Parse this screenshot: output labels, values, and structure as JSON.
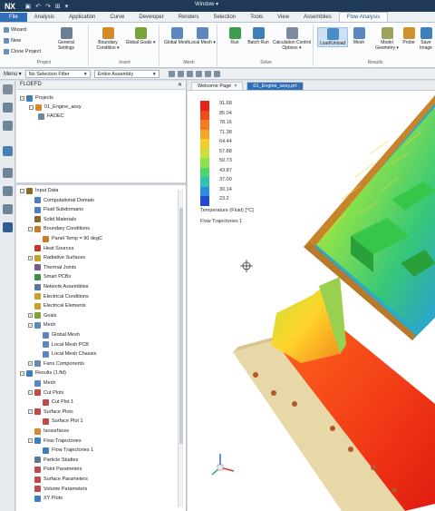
{
  "titlebar": {
    "logo": "NX",
    "window_menu": "Window ▾",
    "quick_icons": [
      "▣",
      "↶",
      "↷",
      "⊞",
      "▾"
    ]
  },
  "tabs": [
    "File",
    "Analysis",
    "Application",
    "Curve",
    "Developer",
    "Renders",
    "Selection",
    "Tools",
    "View",
    "Assemblies",
    "Flow Analysis"
  ],
  "ribbon": {
    "left_items": [
      "Wizard",
      "New",
      "Clone Project"
    ],
    "buttons": [
      {
        "label": "General Settings",
        "color": "#6b7f95"
      },
      {
        "label": "Boundary Condition ▾",
        "color": "#d58a2a"
      },
      {
        "label": "Global Goals ▾",
        "color": "#7aa33a"
      },
      {
        "label": "Global Mesh",
        "color": "#5d87bf"
      },
      {
        "label": "Local Mesh ▾",
        "color": "#5d87bf"
      },
      {
        "label": "Run",
        "color": "#3f9c4a"
      },
      {
        "label": "Batch Run",
        "color": "#3f7fb9"
      },
      {
        "label": "Calculation Control Options ▾",
        "color": "#7a8aa0"
      },
      {
        "label": "Load/Unload",
        "color": "#4a8ec9"
      },
      {
        "label": "Mesh",
        "color": "#5d87bf"
      },
      {
        "label": "Model Geometry ▾",
        "color": "#9fa05a"
      },
      {
        "label": "Probe",
        "color": "#d0902a"
      },
      {
        "label": "Save Image",
        "color": "#3f7fb9"
      }
    ],
    "groups": [
      "Project",
      "Insert",
      "Mesh",
      "Solve",
      "Results"
    ]
  },
  "selbar": {
    "menu": "Menu ▾",
    "filter": "No Selection Filter",
    "scope": "Entire Assembly"
  },
  "navigator": {
    "title": "FLOEFD",
    "projects_root": "Projects",
    "projects": [
      "01_Engine_assy",
      "FAOEC"
    ],
    "tree": [
      {
        "label": "Input Data",
        "level": 0,
        "exp": "−",
        "color": "#8a6a2a"
      },
      {
        "label": "Computational Domain",
        "level": 1,
        "color": "#4f7fbf"
      },
      {
        "label": "Fluid Subdomains",
        "level": 1,
        "color": "#4f7fbf"
      },
      {
        "label": "Solid Materials",
        "level": 1,
        "color": "#8a6a2a"
      },
      {
        "label": "Boundary Conditions",
        "level": 1,
        "exp": "−",
        "color": "#c77a2a"
      },
      {
        "label": "Panel Temp = 90 degC",
        "level": 2,
        "color": "#c77a2a"
      },
      {
        "label": "Heat Sources",
        "level": 1,
        "color": "#c03a2a"
      },
      {
        "label": "Radiative Surfaces",
        "level": 1,
        "exp": "+",
        "color": "#c8a02a"
      },
      {
        "label": "Thermal Joints",
        "level": 1,
        "color": "#7a5a8a"
      },
      {
        "label": "Smart PCBs",
        "level": 1,
        "color": "#3f8f4a"
      },
      {
        "label": "Network Assemblies",
        "level": 1,
        "color": "#5a7a9a"
      },
      {
        "label": "Electrical Conditions",
        "level": 1,
        "color": "#c8a02a"
      },
      {
        "label": "Electrical Elements",
        "level": 1,
        "color": "#c8a02a"
      },
      {
        "label": "Goals",
        "level": 1,
        "exp": "+",
        "color": "#7aa33a"
      },
      {
        "label": "Mesh",
        "level": 1,
        "exp": "−",
        "color": "#5d87bf"
      },
      {
        "label": "Global Mesh",
        "level": 2,
        "color": "#5d87bf"
      },
      {
        "label": "Local Mesh PCB",
        "level": 2,
        "color": "#5d87bf"
      },
      {
        "label": "Local Mesh Chassis",
        "level": 2,
        "color": "#5d87bf"
      },
      {
        "label": "Fans Components",
        "level": 1,
        "exp": "+",
        "color": "#6a8aaa"
      },
      {
        "label": "Results (1.fld)",
        "level": 0,
        "exp": "−",
        "color": "#3f7fb9"
      },
      {
        "label": "Mesh",
        "level": 1,
        "color": "#5d87bf"
      },
      {
        "label": "Cut Plots",
        "level": 1,
        "exp": "−",
        "color": "#c04a4a"
      },
      {
        "label": "Cut Plot 1",
        "level": 2,
        "color": "#c04a4a"
      },
      {
        "label": "Surface Plots",
        "level": 1,
        "exp": "−",
        "color": "#c04a4a"
      },
      {
        "label": "Surface Plot 1",
        "level": 2,
        "color": "#c04a4a"
      },
      {
        "label": "Isosurfaces",
        "level": 1,
        "color": "#d08a3a"
      },
      {
        "label": "Flow Trajectories",
        "level": 1,
        "exp": "−",
        "color": "#3f7fb9"
      },
      {
        "label": "Flow Trajectories 1",
        "level": 2,
        "color": "#3f7fb9"
      },
      {
        "label": "Particle Studies",
        "level": 1,
        "color": "#5a7a9a"
      },
      {
        "label": "Point Parameters",
        "level": 1,
        "color": "#c04a4a"
      },
      {
        "label": "Surface Parameters",
        "level": 1,
        "color": "#c04a4a"
      },
      {
        "label": "Volume Parameters",
        "level": 1,
        "color": "#c04a4a"
      },
      {
        "label": "XY Plots",
        "level": 1,
        "color": "#3f7fb9"
      }
    ]
  },
  "graphics": {
    "tabs": [
      "Welcome Page",
      "01_Engine_assy.prt"
    ],
    "legend": {
      "values": [
        "91.68",
        "85.04",
        "78.16",
        "71.38",
        "64.44",
        "57.88",
        "50.73",
        "43.87",
        "37.00",
        "30.14",
        "23.2"
      ],
      "colors": [
        "#e8211b",
        "#f24a1b",
        "#f87a1e",
        "#f6a623",
        "#efd12a",
        "#c8e23a",
        "#8ee24a",
        "#4cd66e",
        "#2fc4b0",
        "#2a8fe0",
        "#2447d8"
      ],
      "title": "Temperature (Fluid) [°C]",
      "subtitle": "Flow Trajectories 1"
    }
  }
}
